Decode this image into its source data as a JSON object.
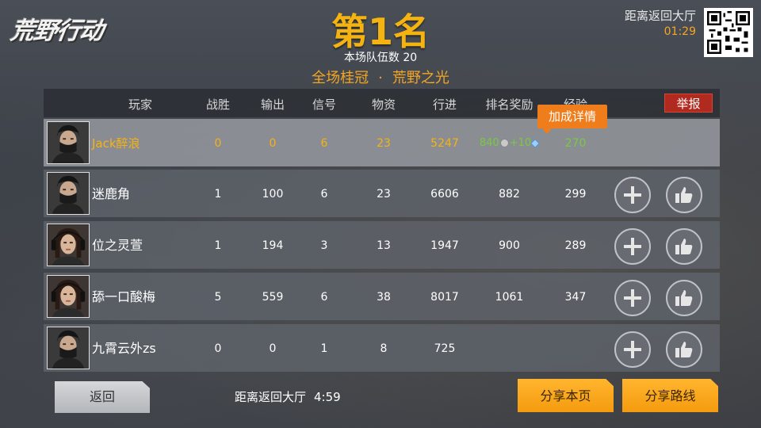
{
  "header": {
    "logo_text": "荒野行动",
    "rank_title": "第1名",
    "team_count_label": "本场队伍数",
    "team_count_value": "20",
    "title_left": "全场桂冠",
    "title_sep": "·",
    "title_right": "荒野之光",
    "return_label": "距离返回大厅",
    "return_time": "01:29"
  },
  "table": {
    "columns": [
      "玩家",
      "战胜",
      "输出",
      "信号",
      "物资",
      "行进",
      "排名奖励",
      "经验"
    ],
    "report_label": "举报",
    "tooltip_label": "加成详情",
    "rows": [
      {
        "name": "Jack醉浪",
        "wins": "0",
        "damage": "0",
        "signal": "6",
        "supplies": "23",
        "distance": "5247",
        "rank_reward": "840",
        "rank_bonus": "+10",
        "exp": "270",
        "is_self": true,
        "avatar": "masked-male"
      },
      {
        "name": "迷鹿角",
        "wins": "1",
        "damage": "100",
        "signal": "6",
        "supplies": "23",
        "distance": "6606",
        "rank_reward": "882",
        "rank_bonus": "",
        "exp": "299",
        "is_self": false,
        "avatar": "masked-male"
      },
      {
        "name": "位之灵萱",
        "wins": "1",
        "damage": "194",
        "signal": "3",
        "supplies": "13",
        "distance": "1947",
        "rank_reward": "900",
        "rank_bonus": "",
        "exp": "289",
        "is_self": false,
        "avatar": "female-headset"
      },
      {
        "name": "舔一口酸梅",
        "wins": "5",
        "damage": "559",
        "signal": "6",
        "supplies": "38",
        "distance": "8017",
        "rank_reward": "1061",
        "rank_bonus": "",
        "exp": "347",
        "is_self": false,
        "avatar": "female-headset"
      },
      {
        "name": "九霄云外zs",
        "wins": "0",
        "damage": "0",
        "signal": "1",
        "supplies": "8",
        "distance": "725",
        "rank_reward": "",
        "rank_bonus": "",
        "exp": "",
        "is_self": false,
        "avatar": "masked-male"
      }
    ]
  },
  "footer": {
    "back_label": "返回",
    "return_label": "距离返回大厅",
    "return_time": "4:59",
    "share_page_label": "分享本页",
    "share_route_label": "分享路线"
  },
  "colors": {
    "accent_gold": "#f5b312",
    "accent_orange": "#f5a623",
    "report_red": "#b12a1f",
    "exp_green": "#7ac943"
  }
}
